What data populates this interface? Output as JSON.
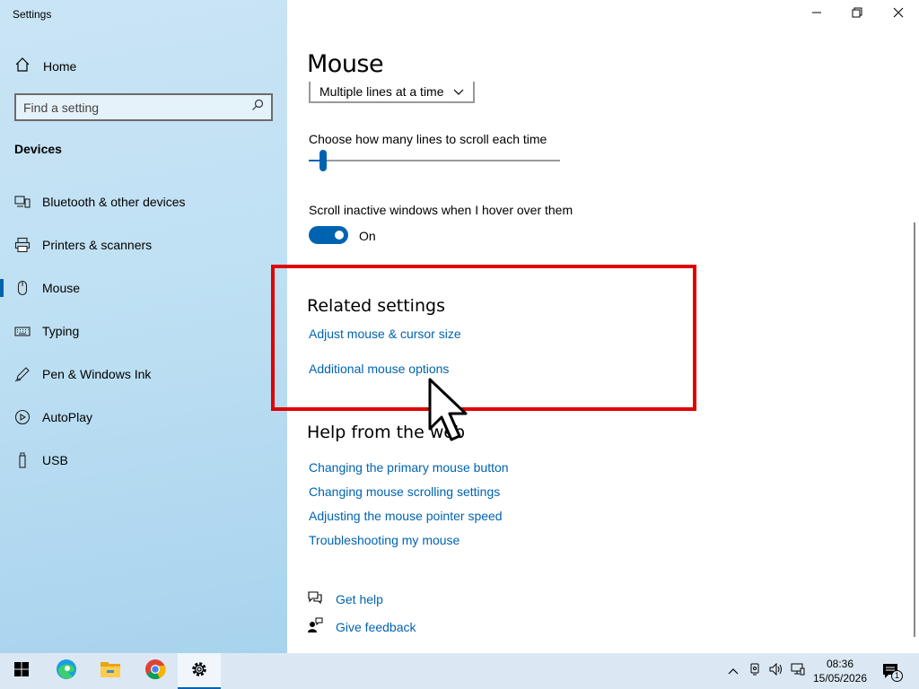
{
  "window": {
    "title": "Settings",
    "controls": {
      "minimize": "minimize-icon",
      "maximize": "restore-icon",
      "close": "close-icon"
    }
  },
  "sidebar": {
    "home_label": "Home",
    "search_placeholder": "Find a setting",
    "section": "Devices",
    "items": [
      {
        "label": "Bluetooth & other devices",
        "icon": "bluetooth-devices-icon"
      },
      {
        "label": "Printers & scanners",
        "icon": "printer-icon"
      },
      {
        "label": "Mouse",
        "icon": "mouse-icon",
        "active": true
      },
      {
        "label": "Typing",
        "icon": "keyboard-icon"
      },
      {
        "label": "Pen & Windows Ink",
        "icon": "pen-icon"
      },
      {
        "label": "AutoPlay",
        "icon": "autoplay-icon"
      },
      {
        "label": "USB",
        "icon": "usb-icon"
      }
    ]
  },
  "main": {
    "title": "Mouse",
    "scroll_mode_value": "Multiple lines at a time",
    "lines_label": "Choose how many lines to scroll each time",
    "lines_slider_fraction": 0.03,
    "inactive_label": "Scroll inactive windows when I hover over them",
    "inactive_state": "On",
    "related": {
      "heading": "Related settings",
      "links": [
        "Adjust mouse & cursor size",
        "Additional mouse options"
      ]
    },
    "help": {
      "heading": "Help from the web",
      "links": [
        "Changing the primary mouse button",
        "Changing mouse scrolling settings",
        "Adjusting the mouse pointer speed",
        "Troubleshooting my mouse"
      ]
    },
    "get_help": "Get help",
    "give_feedback": "Give feedback"
  },
  "taskbar": {
    "apps": [
      "start-icon",
      "edge-icon",
      "file-explorer-icon",
      "chrome-icon",
      "settings-icon"
    ],
    "time": "08:36",
    "date": "15/05/2026",
    "notification_count": "1"
  },
  "colors": {
    "accent": "#0063b1",
    "highlight_border": "#e00000",
    "sidebar_bg": "#bfe0f3",
    "taskbar_bg": "#dbe8f4"
  }
}
